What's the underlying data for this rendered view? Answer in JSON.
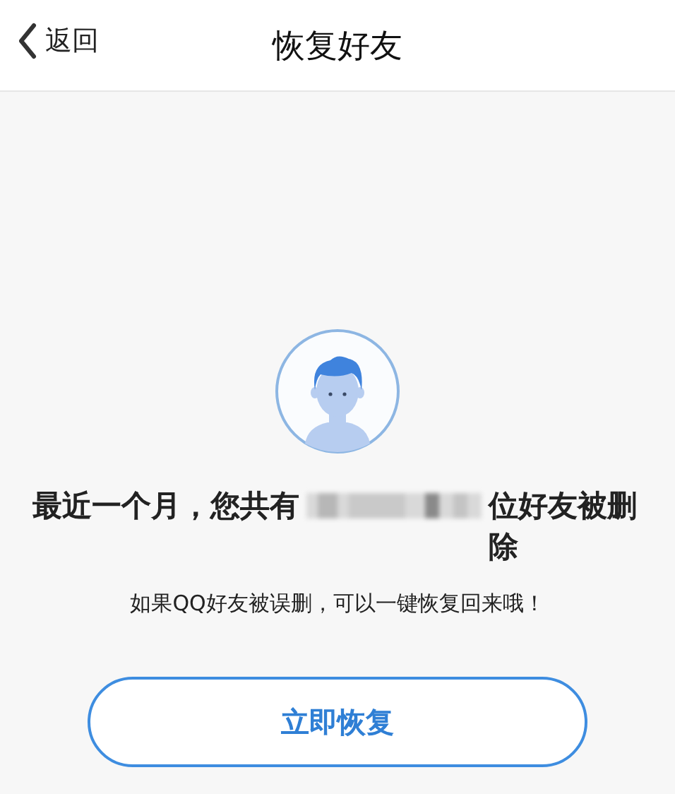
{
  "header": {
    "back_label": "返回",
    "title": "恢复好友"
  },
  "message": {
    "headline_before": "最近一个月，您共有",
    "headline_after": "位好友被删除",
    "hint": "如果QQ好友被误删，可以一键恢复回来哦！"
  },
  "buttons": [
    {
      "label": "立即恢复"
    }
  ]
}
